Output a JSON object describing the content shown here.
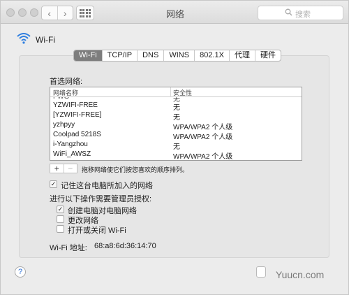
{
  "window": {
    "title": "网络"
  },
  "toolbar": {
    "search_placeholder": "搜索"
  },
  "header": {
    "title": "Wi-Fi"
  },
  "tabs": [
    {
      "label": "Wi-Fi",
      "active": true
    },
    {
      "label": "TCP/IP",
      "active": false
    },
    {
      "label": "DNS",
      "active": false
    },
    {
      "label": "WINS",
      "active": false
    },
    {
      "label": "802.1X",
      "active": false
    },
    {
      "label": "代理",
      "active": false
    },
    {
      "label": "硬件",
      "active": false
    }
  ],
  "preferred": {
    "label": "首选网络:",
    "columns": [
      "网络名称",
      "安全性"
    ],
    "rows": [
      {
        "name": "YZWIFI-FREE",
        "security": "无"
      },
      {
        "name": "[YZWIFI-FREE]",
        "security": "无"
      },
      {
        "name": "yzhpyy",
        "security": "WPA/WPA2 个人级"
      },
      {
        "name": "Coolpad 5218S",
        "security": "WPA/WPA2 个人级"
      },
      {
        "name": "i-Yangzhou",
        "security": "无"
      },
      {
        "name": "WiFi_AWSZ",
        "security": "WPA/WPA2 个人级"
      }
    ],
    "partial_row": {
      "name": "FWG",
      "security": "无"
    },
    "add_label": "+",
    "remove_label": "−",
    "hint": "拖移网络使它们按您喜欢的顺序排列。"
  },
  "options": {
    "remember": {
      "label": "记住这台电脑所加入的网络",
      "checked": true
    },
    "admin_label": "进行以下操作需要管理员授权:",
    "admin_items": [
      {
        "label": "创建电脑对电脑网络",
        "checked": true
      },
      {
        "label": "更改网络",
        "checked": false
      },
      {
        "label": "打开或关闭 Wi-Fi",
        "checked": false
      }
    ]
  },
  "address": {
    "label": "Wi-Fi 地址:",
    "value": "68:a8:6d:36:14:70"
  },
  "footer": {
    "help_label": "?",
    "watermark": "Yuucn.com"
  }
}
